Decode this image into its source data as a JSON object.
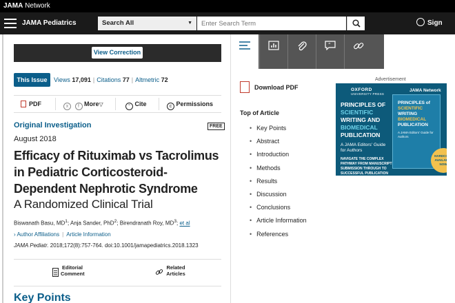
{
  "network": {
    "brand_bold": "JAMA",
    "brand_rest": " Network"
  },
  "header": {
    "journal": "JAMA Pediatrics",
    "search_category": "Search All",
    "search_placeholder": "Enter Search Term",
    "signin": "Sign In"
  },
  "correction": {
    "button": "View Correction"
  },
  "metrics": {
    "issue_badge": "This Issue",
    "views_label": "Views",
    "views": "17,091",
    "citations_label": "Citations",
    "citations": "77",
    "altmetric_label": "Altmetric",
    "altmetric": "72"
  },
  "toolbar": {
    "pdf": "PDF",
    "more": "More",
    "more_caret": "▽",
    "cite": "Cite",
    "permissions": "Permissions"
  },
  "article": {
    "type": "Original Investigation",
    "free": "FREE",
    "date": "August 2018",
    "title": "Efficacy of Rituximab vs Tacrolimus in Pediatric Corticosteroid-Dependent Nephrotic Syndrome",
    "subtitle": "A Randomized Clinical Trial",
    "author1": "Biswanath Basu, MD",
    "author1_sup": "1",
    "author2": "Anja Sander, PhD",
    "author2_sup": "2",
    "author3": "Birendranath Roy, MD",
    "author3_sup": "3",
    "etal": "et al",
    "affiliations": "Author Affiliations",
    "info": "Article Information",
    "citation_journal": "JAMA Pediatr.",
    "citation_rest": " 2018;172(8):757-764. doi:10.1001/jamapediatrics.2018.1323",
    "editorial_comment": "Editorial Comment",
    "related_articles": "Related Articles",
    "keypoints_heading": "Key Points"
  },
  "sidebar": {
    "download_pdf": "Download PDF",
    "toc_heading": "Top of Article",
    "toc": [
      "Key Points",
      "Abstract",
      "Introduction",
      "Methods",
      "Results",
      "Discussion",
      "Conclusions",
      "Article Information",
      "References"
    ]
  },
  "ad": {
    "label": "Advertisement",
    "oxford": "OXFORD",
    "oxford_sub": "UNIVERSITY PRESS",
    "jama": "JAMA Network",
    "head1": "PRINCIPLES OF",
    "head2": "SCIENTIFIC",
    "head3": "WRITING AND",
    "head4": "BIOMEDICAL",
    "head5": "PUBLICATION",
    "guide": "A JAMA Editors' Guide for Authors",
    "nav": "NAVIGATE THE COMPLEX PATHWAY FROM MANUSCRIPT SUBMISSION THROUGH TO SUCCESSFUL PUBLICATION",
    "book_t1": "PRINCIPLES of",
    "book_t2": "SCIENTIFIC",
    "book_t3": "WRITING",
    "book_t4": "BIOMEDICAL",
    "book_t5": "PUBLICATION",
    "book_sub": "A JAMA Editors' Guide for Authors",
    "hardcopy": "HARDCOPY AVAILABLE NOW"
  }
}
